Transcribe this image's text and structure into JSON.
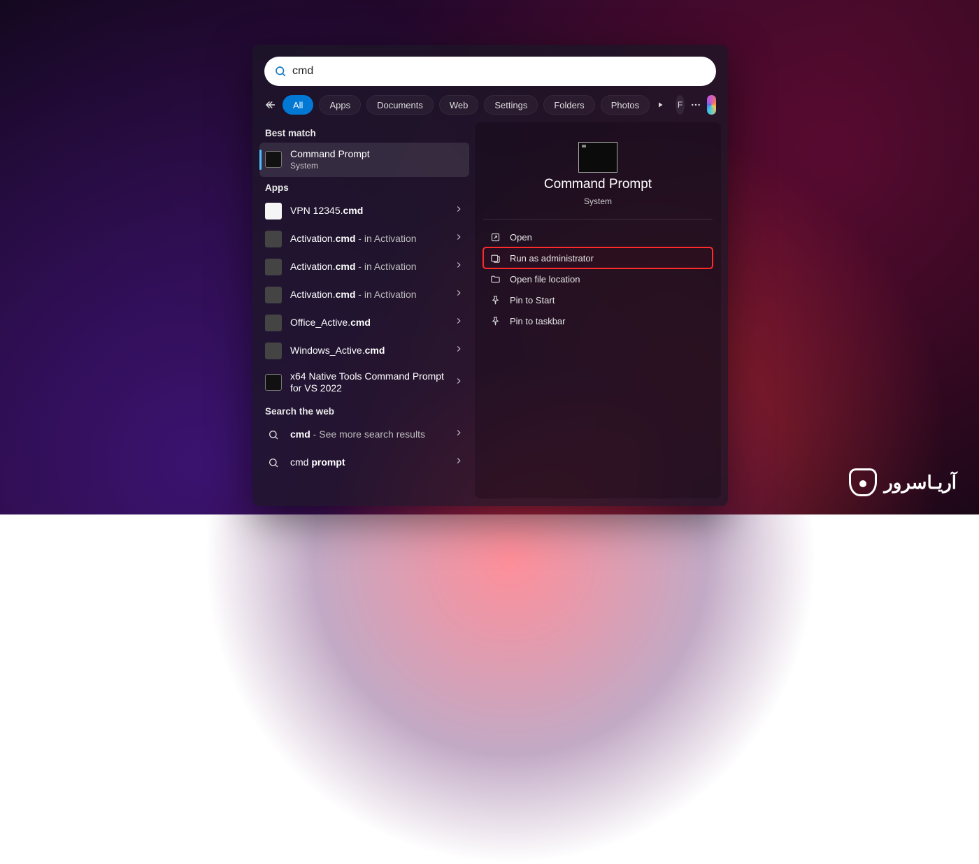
{
  "search": {
    "value": "cmd"
  },
  "filters": {
    "items": [
      {
        "label": "All",
        "active": true
      },
      {
        "label": "Apps"
      },
      {
        "label": "Documents"
      },
      {
        "label": "Web"
      },
      {
        "label": "Settings"
      },
      {
        "label": "Folders"
      },
      {
        "label": "Photos"
      }
    ],
    "avatar_letter": "F"
  },
  "left": {
    "best_match_label": "Best match",
    "best_match": {
      "title": "Command Prompt",
      "subtitle": "System"
    },
    "apps_label": "Apps",
    "apps": [
      {
        "pre": "VPN 12345.",
        "bold": "cmd",
        "sub": ""
      },
      {
        "pre": "Activation.",
        "bold": "cmd",
        "sub": " - in Activation"
      },
      {
        "pre": "Activation.",
        "bold": "cmd",
        "sub": " - in Activation"
      },
      {
        "pre": "Activation.",
        "bold": "cmd",
        "sub": " - in Activation"
      },
      {
        "pre": "Office_Active.",
        "bold": "cmd",
        "sub": ""
      },
      {
        "pre": "Windows_Active.",
        "bold": "cmd",
        "sub": ""
      },
      {
        "pre": "x64 Native Tools Command Prompt for VS 2022",
        "bold": "",
        "sub": ""
      }
    ],
    "web_label": "Search the web",
    "web": [
      {
        "bold": "cmd",
        "rest": " - See more search results"
      },
      {
        "bold": "",
        "rest_pre": "cmd ",
        "rest_bold": "prompt"
      }
    ]
  },
  "detail": {
    "name": "Command Prompt",
    "category": "System",
    "actions": [
      {
        "label": "Open",
        "icon": "open"
      },
      {
        "label": "Run as administrator",
        "icon": "admin",
        "highlight": true
      },
      {
        "label": "Open file location",
        "icon": "folder"
      },
      {
        "label": "Pin to Start",
        "icon": "pin"
      },
      {
        "label": "Pin to taskbar",
        "icon": "pin"
      }
    ]
  },
  "watermark": {
    "text": "آریـاسرور"
  }
}
